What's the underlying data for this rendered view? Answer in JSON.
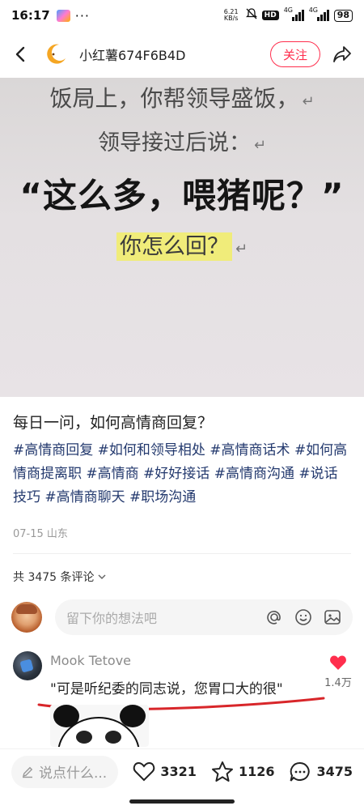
{
  "status_bar": {
    "time": "16:17",
    "more": "···",
    "net_speed_value": "6.21",
    "net_speed_unit": "KB/s",
    "hd_badge": "HD",
    "network_1": "4G",
    "network_2": "4G",
    "battery": "98"
  },
  "header": {
    "author_name": "小红薯674F6B4D",
    "follow_label": "关注"
  },
  "post_image": {
    "line1": "饭局上，你帮领导盛饭，",
    "line2": "领导接过后说：",
    "line3": "“这么多，喂猪呢？”",
    "line4": "你怎么回？",
    "return_mark": "↵"
  },
  "post": {
    "title": "每日一问，如何高情商回复？",
    "tags": "#高情商回复 #如何和领导相处 #高情商话术 #如何高情商提离职 #高情商 #好好接话 #高情商沟通 #说话技巧 #高情商聊天 #职场沟通",
    "meta": "07-15 山东"
  },
  "comments": {
    "count_label": "共 3475 条评论",
    "input_placeholder": "留下你的想法吧",
    "first": {
      "author": "Mook Tetove",
      "text": "\"可是听纪委的同志说，您胃口大的很\"",
      "likes": "1.4万"
    }
  },
  "bottom_bar": {
    "say_placeholder": "说点什么...",
    "likes": "3321",
    "collects": "1126",
    "comments": "3475"
  },
  "colors": {
    "accent": "#ff2e4d",
    "tag": "#23396e",
    "highlight": "#f0ec7a"
  }
}
